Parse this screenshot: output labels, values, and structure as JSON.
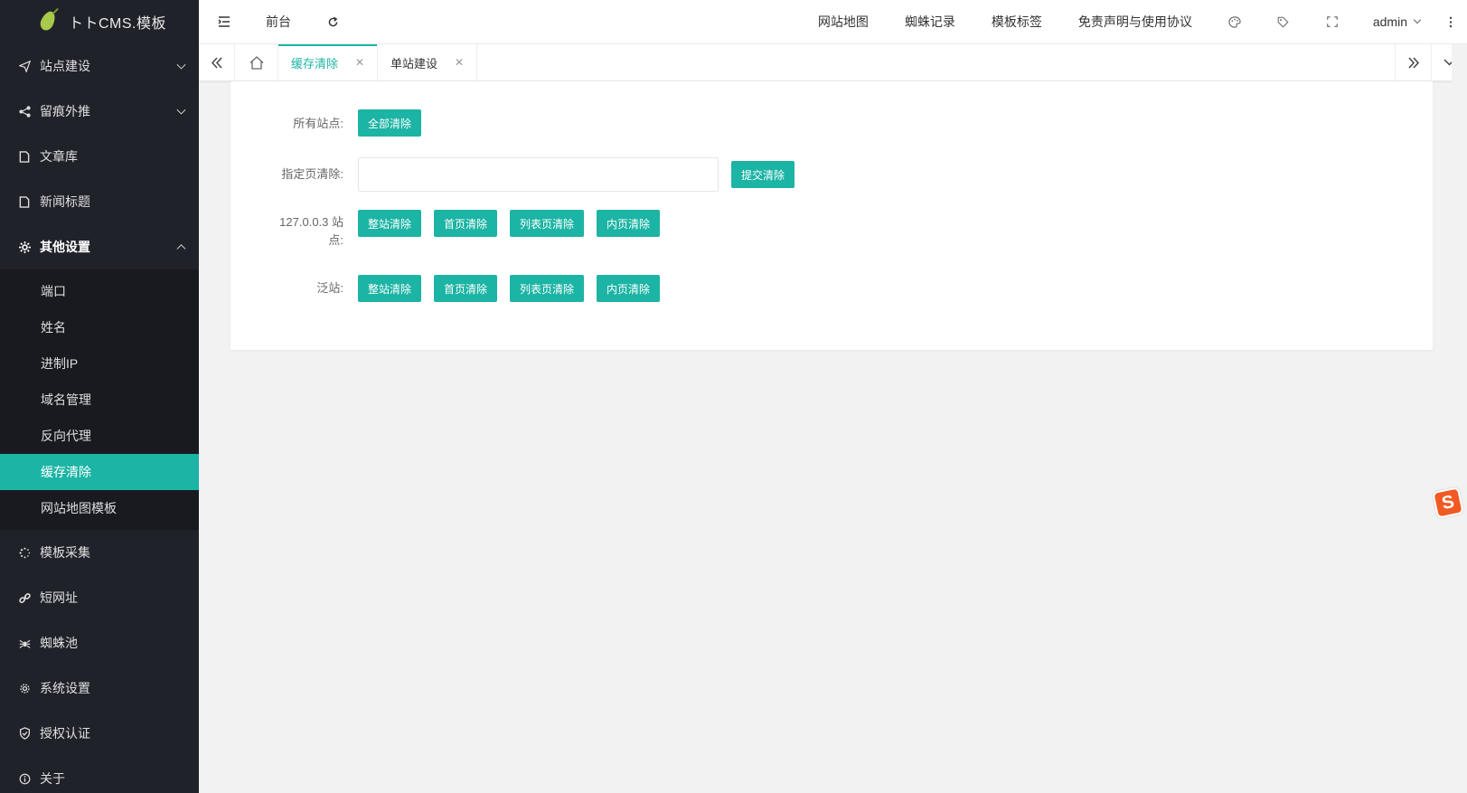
{
  "app": {
    "logo_text": "トトCMS.模板"
  },
  "sidebar": {
    "items": [
      {
        "label": "站点建设",
        "icon": "paper-plane-icon",
        "expandable": true,
        "open": false
      },
      {
        "label": "留痕外推",
        "icon": "share-icon",
        "expandable": true,
        "open": false
      },
      {
        "label": "文章库",
        "icon": "file-icon"
      },
      {
        "label": "新闻标题",
        "icon": "file-icon"
      },
      {
        "label": "其他设置",
        "icon": "gear-icon",
        "expandable": true,
        "open": true
      }
    ],
    "sub_items": [
      {
        "label": "端口"
      },
      {
        "label": "姓名"
      },
      {
        "label": "进制IP"
      },
      {
        "label": "域名管理"
      },
      {
        "label": "反向代理"
      },
      {
        "label": "缓存清除",
        "active": true
      },
      {
        "label": "网站地图模板"
      }
    ],
    "items_after": [
      {
        "label": "模板采集",
        "icon": "spinner-icon"
      },
      {
        "label": "短网址",
        "icon": "link-icon"
      },
      {
        "label": "蜘蛛池",
        "icon": "spider-icon"
      },
      {
        "label": "系统设置",
        "icon": "settings-icon"
      },
      {
        "label": "授权认证",
        "icon": "shield-check-icon"
      },
      {
        "label": "关于",
        "icon": "info-icon"
      }
    ]
  },
  "header": {
    "front_label": "前台",
    "links": [
      "网站地图",
      "蜘蛛记录",
      "模板标签",
      "免责声明与使用协议"
    ],
    "user": "admin"
  },
  "tabs": [
    {
      "label": "缓存清除",
      "active": true
    },
    {
      "label": "单站建设",
      "active": false
    }
  ],
  "form": {
    "all_sites_label": "所有站点:",
    "all_sites_button": "全部清除",
    "page_clear_label": "指定页清除:",
    "page_clear_value": "",
    "page_clear_button": "提交清除",
    "site_label": "127.0.0.3 站点:",
    "site_buttons": [
      "整站清除",
      "首页清除",
      "列表页清除",
      "内页清除"
    ],
    "pan_label": "泛站:",
    "pan_buttons": [
      "整站清除",
      "首页清除",
      "列表页清除",
      "内页清除"
    ]
  },
  "colors": {
    "accent": "#1cb4a4",
    "sidebar_bg": "#20222a",
    "sidebar_sub_bg": "#181a20"
  }
}
